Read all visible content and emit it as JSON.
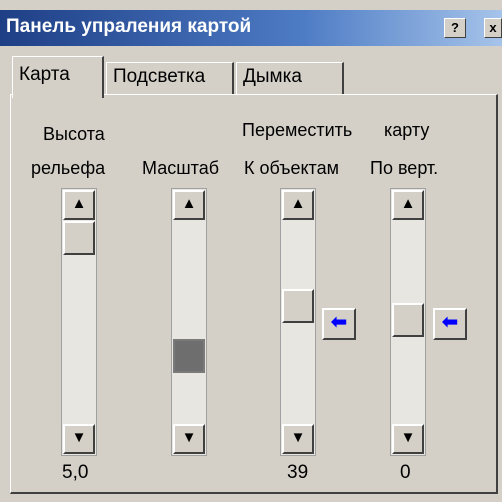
{
  "window": {
    "title": "Панель упраления картой",
    "help_button": "?",
    "close_button": "x"
  },
  "tabs": [
    {
      "label": "Карта",
      "active": true
    },
    {
      "label": "Подсветка",
      "active": false
    },
    {
      "label": "Дымка",
      "active": false
    }
  ],
  "labels": {
    "height_line1": "Высота",
    "height_line2": "рельефа",
    "scale": "Масштаб",
    "move_title_part1": "Переместить",
    "move_title_part2": "карту",
    "to_objects": "К объектам",
    "vertical": "По верт."
  },
  "scrollbars": [
    {
      "id": "height",
      "value": "5,0",
      "up_icon": "▲",
      "down_icon": "▼"
    },
    {
      "id": "scale",
      "value": "",
      "up_icon": "▲",
      "down_icon": "▼"
    },
    {
      "id": "to_objects",
      "value": "39",
      "up_icon": "▲",
      "down_icon": "▼"
    },
    {
      "id": "vertical",
      "value": "0",
      "up_icon": "▲",
      "down_icon": "▼"
    }
  ],
  "move_buttons": {
    "to_objects_arrow": "⬅",
    "vertical_arrow": "⬅",
    "arrow_color": "#0000ff"
  },
  "colors": {
    "window_bg": "#d4d0c8",
    "title_start": "#1e3f86",
    "title_end": "#a6c4ea"
  }
}
